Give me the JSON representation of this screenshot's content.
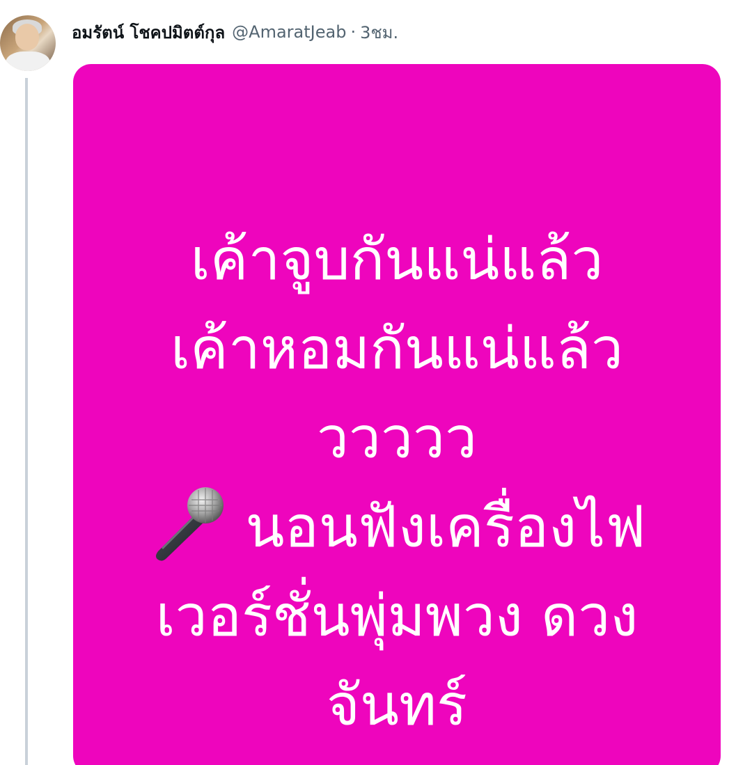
{
  "tweet": {
    "display_name": "อมรัตน์ โชคปมิตต์กุล",
    "handle": "@AmaratJeab",
    "separator": "·",
    "time": "3ชม."
  },
  "media": {
    "background_color": "#ee05bd",
    "text_color": "#ffffff",
    "lines": [
      "เค้าจูบกันแน่แล้ว",
      "เค้าหอมกันแน่แล้ว",
      "ววววว",
      "นอนฟังเครื่องไฟ",
      "เวอร์ชั่นพุ่มพวง ดวง",
      "จันทร์"
    ],
    "inline_icon": "microphone-icon"
  }
}
